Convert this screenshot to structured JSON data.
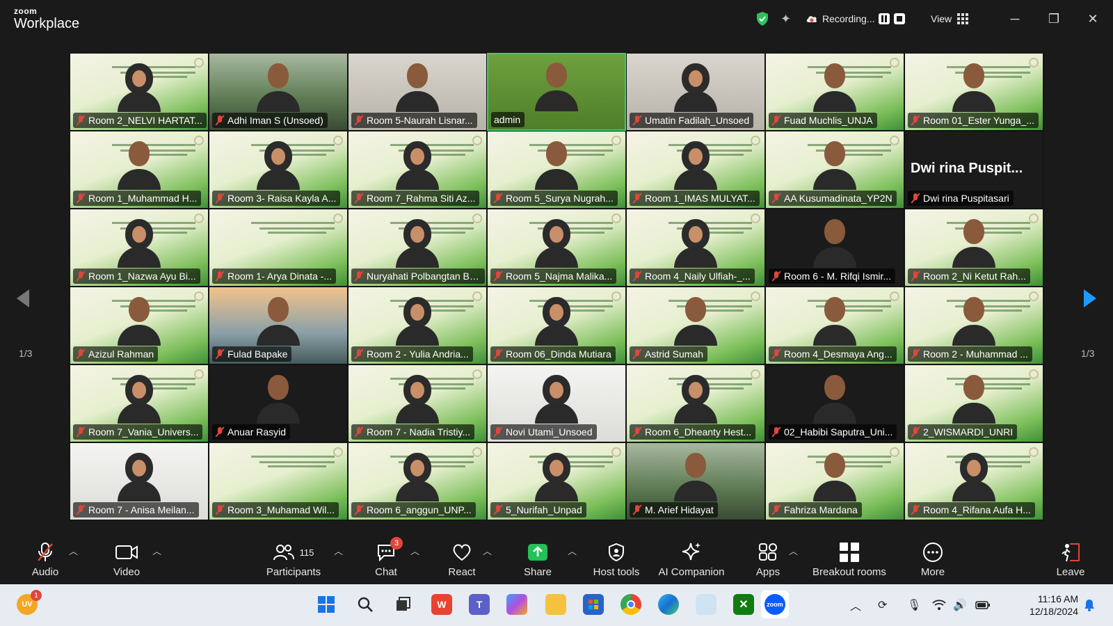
{
  "app": {
    "brand_small": "zoom",
    "brand_big": "Workplace"
  },
  "titlebar": {
    "recording_label": "Recording...",
    "view_label": "View"
  },
  "pager": {
    "left": "1/3",
    "right": "1/3"
  },
  "participants": [
    {
      "name": "Room 2_NELVI HARTAT...",
      "bg": "slide",
      "p": "hijab"
    },
    {
      "name": "Adhi Iman S (Unsoed)",
      "bg": "photo",
      "p": "man"
    },
    {
      "name": "Room 5-Naurah Lisnar...",
      "bg": "indoor",
      "p": "woman"
    },
    {
      "name": "admin",
      "bg": "green",
      "p": "man",
      "active": true
    },
    {
      "name": "Umatin Fadilah_Unsoed",
      "bg": "indoor",
      "p": "hijab"
    },
    {
      "name": "Fuad Muchlis_UNJA",
      "bg": "slide",
      "p": "man"
    },
    {
      "name": "Room 01_Ester Yunga_...",
      "bg": "slide",
      "p": "woman"
    },
    {
      "name": "Room 1_Muhammad H...",
      "bg": "slide",
      "p": "man"
    },
    {
      "name": "Room 3- Raisa Kayla A...",
      "bg": "slide",
      "p": "hijab"
    },
    {
      "name": "Room 7_Rahma Siti Az...",
      "bg": "slide",
      "p": "hijab"
    },
    {
      "name": "Room 5_Surya Nugrah...",
      "bg": "slide",
      "p": "man"
    },
    {
      "name": "Room 1_IMAS MULYAT...",
      "bg": "slide",
      "p": "hijab"
    },
    {
      "name": "AA Kusumadinata_YP2N",
      "bg": "slide",
      "p": "man"
    },
    {
      "name": "Dwi rina Puspitasari",
      "bg": "dark",
      "p": "none",
      "big": "Dwi rina Puspit..."
    },
    {
      "name": "Room 1_Nazwa Ayu Bi...",
      "bg": "slide",
      "p": "hijab"
    },
    {
      "name": "Room 1- Arya Dinata -...",
      "bg": "slide",
      "p": "none"
    },
    {
      "name": "Nuryahati Polbangtan Bo...",
      "bg": "slide",
      "p": "hijab"
    },
    {
      "name": "Room 5_Najma Malika...",
      "bg": "slide",
      "p": "hijab"
    },
    {
      "name": "Room 4_Naily Ulfiah-_...",
      "bg": "slide",
      "p": "hijab"
    },
    {
      "name": "Room 6 - M. Rifqi Ismir...",
      "bg": "dark",
      "p": "man"
    },
    {
      "name": "Room 2_Ni Ketut Rah...",
      "bg": "slide",
      "p": "woman"
    },
    {
      "name": "Azizul Rahman",
      "bg": "slide",
      "p": "man"
    },
    {
      "name": "Fulad Bapake",
      "bg": "sunset",
      "p": "man"
    },
    {
      "name": "Room 2 - Yulia Andria...",
      "bg": "slide",
      "p": "hijab"
    },
    {
      "name": "Room 06_Dinda Mutiara",
      "bg": "slide",
      "p": "hijab"
    },
    {
      "name": "Astrid Sumah",
      "bg": "slide",
      "p": "woman"
    },
    {
      "name": "Room 4_Desmaya Ang...",
      "bg": "slide",
      "p": "woman"
    },
    {
      "name": "Room 2 - Muhammad ...",
      "bg": "slide",
      "p": "man"
    },
    {
      "name": "Room 7_Vania_Univers...",
      "bg": "slide",
      "p": "hijab"
    },
    {
      "name": "Anuar Rasyid",
      "bg": "dark",
      "p": "man"
    },
    {
      "name": "Room 7 - Nadia Tristiy...",
      "bg": "slide",
      "p": "hijab"
    },
    {
      "name": "Novi Utami_Unsoed",
      "bg": "white",
      "p": "hijab"
    },
    {
      "name": "Room 6_Dheanty Hest...",
      "bg": "slide",
      "p": "hijab"
    },
    {
      "name": "02_Habibi Saputra_Uni...",
      "bg": "dark",
      "p": "man"
    },
    {
      "name": "2_WISMARDI_UNRI",
      "bg": "slide",
      "p": "man"
    },
    {
      "name": "Room 7 - Anisa Meilan...",
      "bg": "white",
      "p": "hijab"
    },
    {
      "name": "Room 3_Muhamad Wil...",
      "bg": "slide",
      "p": "none"
    },
    {
      "name": "Room 6_anggun_UNP...",
      "bg": "slide",
      "p": "hijab"
    },
    {
      "name": "5_Nurifah_Unpad",
      "bg": "slide",
      "p": "hijab"
    },
    {
      "name": "M. Arief Hidayat",
      "bg": "photo",
      "p": "man"
    },
    {
      "name": "Fahriza Mardana",
      "bg": "slide",
      "p": "man"
    },
    {
      "name": "Room 4_Rifana Aufa H...",
      "bg": "slide",
      "p": "hijab"
    }
  ],
  "toolbar": {
    "audio": "Audio",
    "video": "Video",
    "participants": "Participants",
    "participants_count": "115",
    "chat": "Chat",
    "chat_badge": "3",
    "react": "React",
    "share": "Share",
    "host_tools": "Host tools",
    "ai_companion": "AI Companion",
    "apps": "Apps",
    "breakout_rooms": "Breakout rooms",
    "more": "More",
    "leave": "Leave"
  },
  "taskbar": {
    "weather_badge": "1",
    "time": "11:16 AM",
    "date": "12/18/2024"
  },
  "colors": {
    "accent": "#0e72ed",
    "active_speaker": "#2fd36b",
    "muted": "#e0463b",
    "share": "#23c157"
  }
}
